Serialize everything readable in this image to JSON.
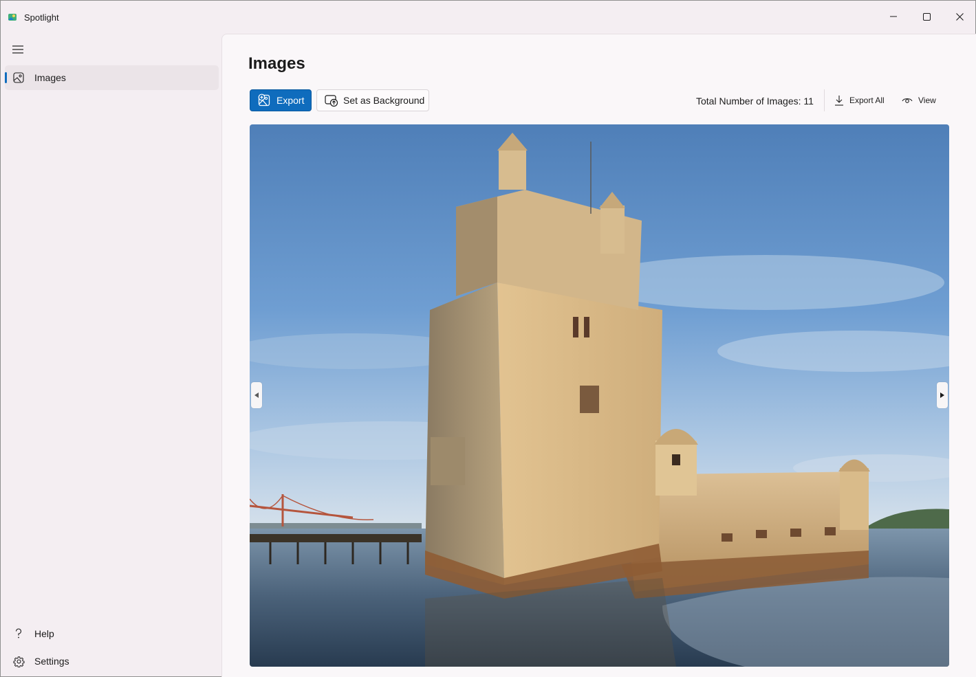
{
  "window": {
    "title": "Spotlight",
    "controls": {
      "minimize": "minimize",
      "maximize": "maximize",
      "close": "close"
    }
  },
  "sidebar": {
    "menu_icon": "hamburger-menu-icon",
    "items": [
      {
        "label": "Images",
        "icon": "image-icon",
        "selected": true
      }
    ],
    "footer": [
      {
        "label": "Help",
        "icon": "question-icon"
      },
      {
        "label": "Settings",
        "icon": "gear-icon"
      }
    ]
  },
  "main": {
    "title": "Images",
    "toolbar": {
      "export_label": "Export",
      "set_background_label": "Set as Background",
      "total_label": "Total Number of Images: 11",
      "export_all_label": "Export All",
      "view_label": "View"
    },
    "viewer": {
      "image_alt": "Belém Tower on the Tagus river at sunset with a suspension bridge in the distance",
      "prev_icon": "caret-left-icon",
      "next_icon": "caret-right-icon"
    }
  },
  "colors": {
    "accent": "#0f6cbd",
    "sidebar_bg": "#f4eef2",
    "content_bg": "#faf7f9"
  }
}
